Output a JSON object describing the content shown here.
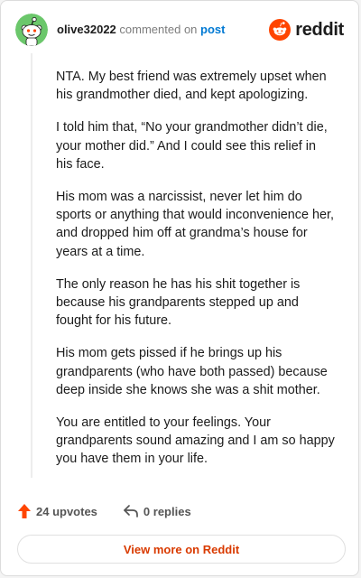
{
  "header": {
    "username": "olive32022",
    "action_text": "commented on",
    "post_link": "post",
    "brand_word": "reddit"
  },
  "comment": {
    "paragraphs": [
      "NTA. My best friend was extremely upset when his grandmother died, and kept apologizing.",
      "I told him that, “No your grandmother didn’t die, your mother did.” And I could see this relief in his face.",
      "His mom was a narcissist, never let him do sports or anything that would inconvenience her, and dropped him off at grandma’s house for years at a time.",
      "The only reason he has his shit together is because his grandparents stepped up and fought for his future.",
      "His mom gets pissed if he brings up his grandparents (who have both passed) because deep inside she knows she was a shit mother.",
      "You are entitled to your feelings. Your grandparents sound amazing and I am so happy you have them in your life."
    ]
  },
  "actions": {
    "upvotes": "24 upvotes",
    "replies": "0 replies"
  },
  "view_more": {
    "label": "View more on Reddit"
  },
  "icons": {
    "avatar": "snoo-avatar-icon",
    "brand": "reddit-logo-icon",
    "upvote": "upvote-arrow-icon",
    "reply": "reply-arrow-icon"
  },
  "colors": {
    "brand_orange": "#ff4500",
    "link_blue": "#0079d3",
    "upvote_orange": "#ff4500",
    "view_more_text": "#d93a00",
    "avatar_green": "#6bc76b"
  }
}
